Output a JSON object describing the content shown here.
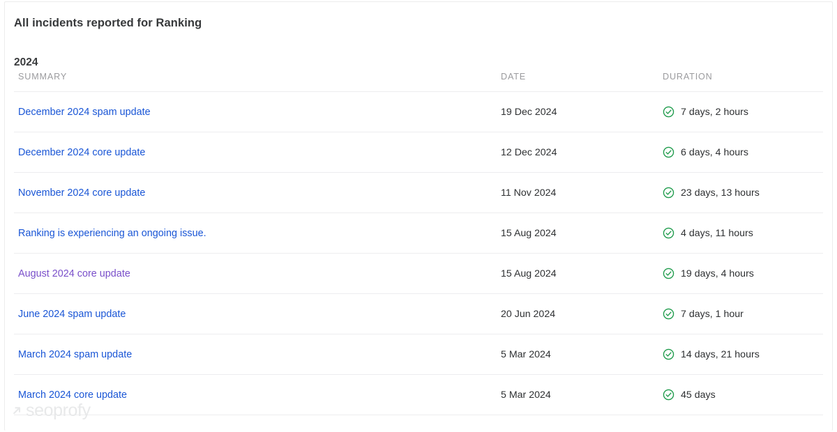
{
  "header": {
    "title": "All incidents reported for Ranking"
  },
  "section": {
    "year": "2024"
  },
  "table": {
    "columns": {
      "summary": "SUMMARY",
      "date": "DATE",
      "duration": "DURATION"
    },
    "rows": [
      {
        "summary": "December 2024 spam update",
        "summary_state": "unvisited",
        "date": "19 Dec 2024",
        "duration": "7 days, 2 hours",
        "status_icon": "check-circle-icon"
      },
      {
        "summary": "December 2024 core update",
        "summary_state": "unvisited",
        "date": "12 Dec 2024",
        "duration": "6 days, 4 hours",
        "status_icon": "check-circle-icon"
      },
      {
        "summary": "November 2024 core update",
        "summary_state": "unvisited",
        "date": "11 Nov 2024",
        "duration": "23 days, 13 hours",
        "status_icon": "check-circle-icon"
      },
      {
        "summary": "Ranking is experiencing an ongoing issue.",
        "summary_state": "unvisited",
        "date": "15 Aug 2024",
        "duration": "4 days, 11 hours",
        "status_icon": "check-circle-icon"
      },
      {
        "summary": "August 2024 core update",
        "summary_state": "visited",
        "date": "15 Aug 2024",
        "duration": "19 days, 4 hours",
        "status_icon": "check-circle-icon"
      },
      {
        "summary": "June 2024 spam update",
        "summary_state": "unvisited",
        "date": "20 Jun 2024",
        "duration": "7 days, 1 hour",
        "status_icon": "check-circle-icon"
      },
      {
        "summary": "March 2024 spam update",
        "summary_state": "unvisited",
        "date": "5 Mar 2024",
        "duration": "14 days, 21 hours",
        "status_icon": "check-circle-icon"
      },
      {
        "summary": "March 2024 core update",
        "summary_state": "unvisited",
        "date": "5 Mar 2024",
        "duration": "45 days",
        "status_icon": "check-circle-icon"
      }
    ]
  },
  "watermark": {
    "text": "seoprofy",
    "icon": "arrow-up-right-icon"
  },
  "colors": {
    "link": "#1a56d6",
    "link_visited": "#7a4fca",
    "status_ok": "#1e9b4b",
    "title": "#37393b",
    "column_header": "#9b9b9e",
    "row_divider": "#ededef",
    "watermark": "#e8e9ea"
  }
}
